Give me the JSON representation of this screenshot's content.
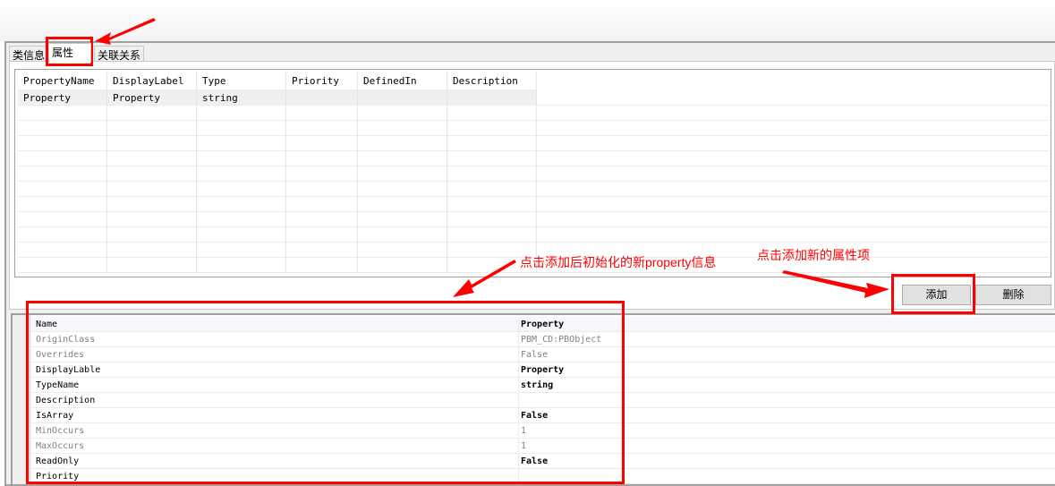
{
  "tabs": [
    {
      "label": "类信息"
    },
    {
      "label": "属性"
    },
    {
      "label": "关联关系"
    }
  ],
  "grid": {
    "columns": [
      "PropertyName",
      "DisplayLabel",
      "Type",
      "Priority",
      "DefinedIn",
      "Description"
    ],
    "rows": [
      [
        "Property",
        "Property",
        "string",
        "",
        "",
        ""
      ]
    ]
  },
  "buttons": {
    "add": "添加",
    "delete": "删除"
  },
  "properties": [
    {
      "name": "Name",
      "value": "Property",
      "state": "bold"
    },
    {
      "name": "OriginClass",
      "value": "PBM_CD:PBObject",
      "state": "dim"
    },
    {
      "name": "Overrides",
      "value": "False",
      "state": "dim"
    },
    {
      "name": "DisplayLable",
      "value": "Property",
      "state": "bold"
    },
    {
      "name": "TypeName",
      "value": "string",
      "state": "bold"
    },
    {
      "name": "Description",
      "value": "",
      "state": "normal"
    },
    {
      "name": "IsArray",
      "value": "False",
      "state": "bold"
    },
    {
      "name": "MinOccurs",
      "value": "1",
      "state": "dim"
    },
    {
      "name": "MaxOccurs",
      "value": "1",
      "state": "dim"
    },
    {
      "name": "ReadOnly",
      "value": "False",
      "state": "bold"
    },
    {
      "name": "Priority",
      "value": "",
      "state": "normal"
    }
  ],
  "annotations": {
    "init_note": "点击添加后初始化的新property信息",
    "add_note": "点击添加新的属性项"
  },
  "colors": {
    "annotation": "#ff0000"
  }
}
